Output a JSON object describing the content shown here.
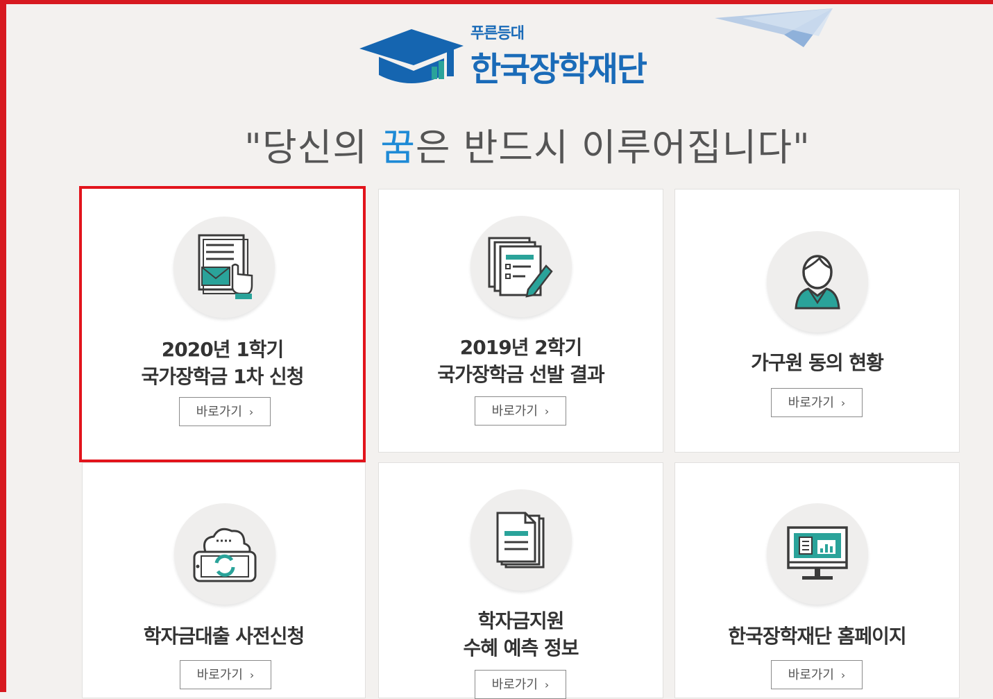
{
  "logo": {
    "small_text": "푸른등대",
    "main_text": "한국장학재단"
  },
  "slogan": {
    "before": "\"당신의 ",
    "highlight": "꿈",
    "after": "은 반드시 이루어집니다\""
  },
  "colors": {
    "accent_blue": "#1a6bb8",
    "highlight_red": "#e2141c",
    "icon_teal": "#2aa39a"
  },
  "cards": [
    {
      "line1": "2020년 1학기",
      "line2": "국가장학금 1차 신청",
      "button": "바로가기",
      "icon": "application-form-icon"
    },
    {
      "line1": "2019년 2학기",
      "line2": "국가장학금 선발 결과",
      "button": "바로가기",
      "icon": "documents-pen-icon"
    },
    {
      "line1": "가구원 동의 현황",
      "button": "바로가기",
      "icon": "person-icon"
    },
    {
      "line1": "학자금대출 사전신청",
      "button": "바로가기",
      "icon": "cloud-phone-icon"
    },
    {
      "line1": "학자금지원",
      "line2": "수혜 예측 정보",
      "button": "바로가기",
      "icon": "document-stack-icon"
    },
    {
      "line1": "한국장학재단 홈페이지",
      "button": "바로가기",
      "icon": "monitor-icon"
    }
  ]
}
